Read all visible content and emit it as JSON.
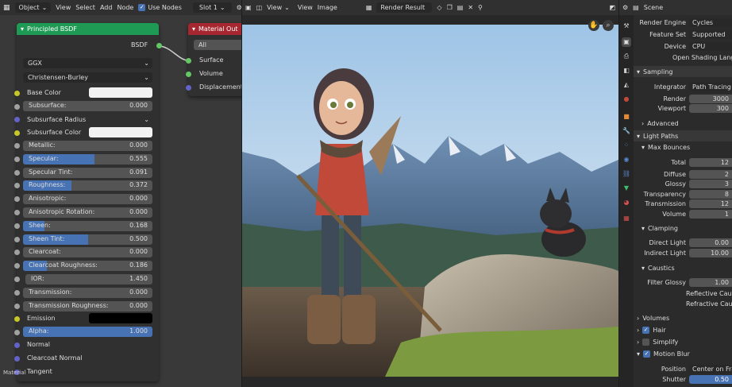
{
  "node_editor_header": {
    "object_mode": "Object",
    "menus": [
      "View",
      "Select",
      "Add",
      "Node"
    ],
    "use_nodes_label": "Use Nodes",
    "slot": "Slot 1"
  },
  "image_editor_header": {
    "menus": [
      "View",
      "View",
      "Image"
    ],
    "image_name": "Render Result"
  },
  "properties_header": {
    "scene": "Scene"
  },
  "bsdf_node": {
    "title": "Principled BSDF",
    "output_label": "BSDF",
    "distribution": "GGX",
    "subsurface_method": "Christensen-Burley",
    "base_color_label": "Base Color",
    "subsurface_label": "Subsurface:",
    "subsurface_value": "0.000",
    "subsurface_radius_label": "Subsurface Radius",
    "subsurface_color_label": "Subsurface Color",
    "params": [
      {
        "label": "Metallic:",
        "value": "0.000",
        "fill": 0.0
      },
      {
        "label": "Specular:",
        "value": "0.555",
        "fill": 0.555
      },
      {
        "label": "Specular Tint:",
        "value": "0.091",
        "fill": 0.0
      },
      {
        "label": "Roughness:",
        "value": "0.372",
        "fill": 0.372
      },
      {
        "label": "Anisotropic:",
        "value": "0.000",
        "fill": 0.0
      },
      {
        "label": "Anisotropic Rotation:",
        "value": "0.000",
        "fill": 0.0
      },
      {
        "label": "Sheen:",
        "value": "0.168",
        "fill": 0.168
      },
      {
        "label": "Sheen Tint:",
        "value": "0.500",
        "fill": 0.5
      },
      {
        "label": "Clearcoat:",
        "value": "0.000",
        "fill": 0.0
      },
      {
        "label": "Clearcoat Roughness:",
        "value": "0.186",
        "fill": 0.186
      },
      {
        "label": "IOR:",
        "value": "1.450",
        "fill": 0.0
      },
      {
        "label": "Transmission:",
        "value": "0.000",
        "fill": 0.0
      },
      {
        "label": "Transmission Roughness:",
        "value": "0.000",
        "fill": 0.0
      }
    ],
    "emission_label": "Emission",
    "alpha_label": "Alpha:",
    "alpha_value": "1.000",
    "alpha_fill": 1.0,
    "inputs_tail": [
      "Normal",
      "Clearcoat Normal",
      "Tangent"
    ]
  },
  "material_output_node": {
    "title": "Material Out",
    "target": "All",
    "inputs": [
      "Surface",
      "Volume",
      "Displacement"
    ]
  },
  "material_tab_label": "Material",
  "render_props": {
    "render_engine_label": "Render Engine",
    "render_engine": "Cycles",
    "feature_set_label": "Feature Set",
    "feature_set": "Supported",
    "device_label": "Device",
    "device": "CPU",
    "osl_label": "Open Shading Language",
    "sampling": {
      "title": "Sampling",
      "integrator_label": "Integrator",
      "integrator": "Path Tracing",
      "render_label": "Render",
      "render_value": "3000",
      "viewport_label": "Viewport",
      "viewport_value": "300",
      "advanced": "Advanced"
    },
    "light_paths": {
      "title": "Light Paths",
      "max_bounces": "Max Bounces",
      "rows": [
        {
          "label": "Total",
          "value": "12"
        },
        {
          "label": "Diffuse",
          "value": "2"
        },
        {
          "label": "Glossy",
          "value": "3"
        },
        {
          "label": "Transparency",
          "value": "8"
        },
        {
          "label": "Transmission",
          "value": "12"
        },
        {
          "label": "Volume",
          "value": "1"
        }
      ],
      "clamping": "Clamping",
      "direct_light_label": "Direct Light",
      "direct_light": "0.00",
      "indirect_light_label": "Indirect Light",
      "indirect_light": "10.00",
      "caustics": "Caustics",
      "filter_glossy_label": "Filter Glossy",
      "filter_glossy": "1.00",
      "reflective_caustics": "Reflective Caustics",
      "refractive_caustics": "Refractive Caustics"
    },
    "volumes": "Volumes",
    "hair": "Hair",
    "simplify": "Simplify",
    "motion_blur": "Motion Blur",
    "position_label": "Position",
    "position": "Center on Frame",
    "shutter_label": "Shutter",
    "shutter": "0.50"
  },
  "colors": {
    "bsdf_header": "#1e9a55",
    "output_header": "#a6272f",
    "accent": "#4772b3",
    "panel_bg": "#303030",
    "editor_bg": "#393939"
  }
}
